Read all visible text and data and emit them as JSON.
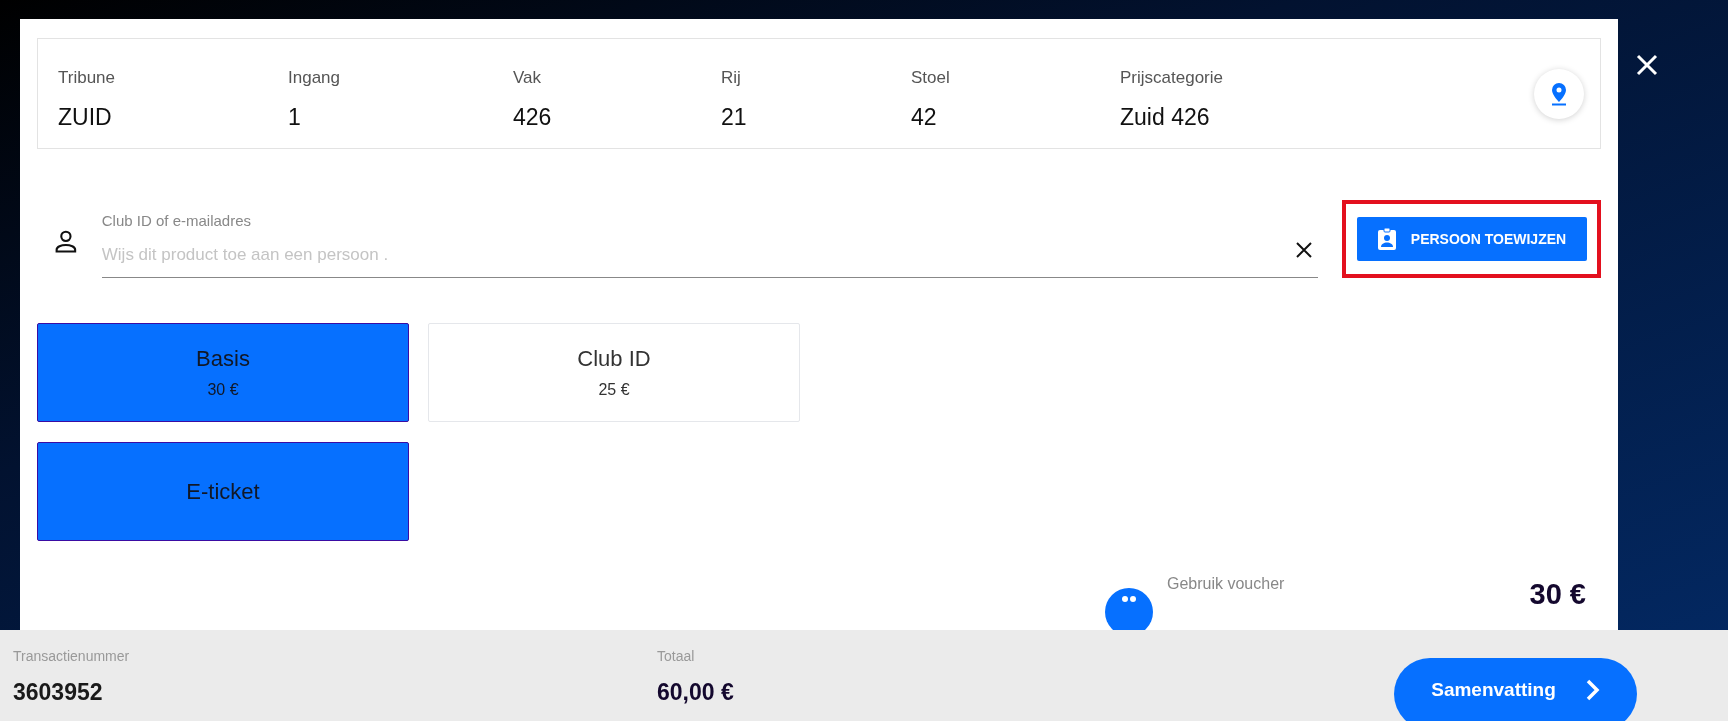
{
  "seat_info": [
    {
      "label": "Tribune",
      "value": "ZUID"
    },
    {
      "label": "Ingang",
      "value": "1"
    },
    {
      "label": "Vak",
      "value": "426"
    },
    {
      "label": "Rij",
      "value": "21"
    },
    {
      "label": "Stoel",
      "value": "42"
    },
    {
      "label": "Prijscategorie",
      "value": "Zuid 426"
    }
  ],
  "assign": {
    "label": "Club ID of e-mailadres",
    "placeholder": "Wijs dit product toe aan een persoon .",
    "button": "PERSOON TOEWIJZEN",
    "highlighted": true
  },
  "options": [
    {
      "title": "Basis",
      "price": "30 €",
      "selected": true
    },
    {
      "title": "Club ID",
      "price": "25 €",
      "selected": false
    },
    {
      "title": "E-ticket",
      "selected": true
    }
  ],
  "voucher": {
    "label": "Gebruik voucher",
    "price": "30 €"
  },
  "footer": {
    "transaction_label": "Transactienummer",
    "transaction": "3603952",
    "total_label": "Totaal",
    "total": "60,00 €",
    "button": "Samenvatting"
  }
}
